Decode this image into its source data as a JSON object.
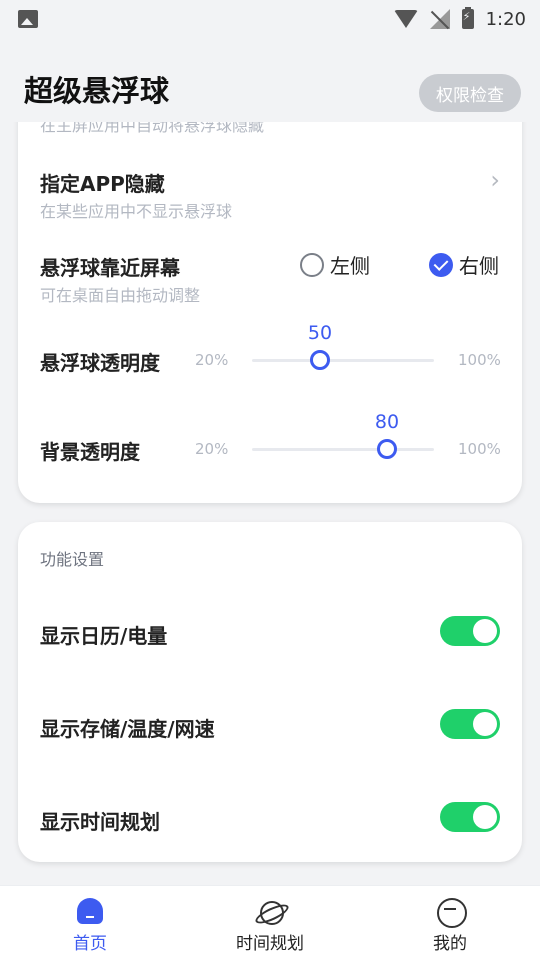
{
  "status_bar": {
    "time": "1:20"
  },
  "header": {
    "title": "超级悬浮球",
    "permission_button": "权限检查"
  },
  "floating_settings": {
    "clipped_hint": "在主屏应用中自动将悬浮球隐藏",
    "hide_in_apps": {
      "title": "指定APP隐藏",
      "subtitle": "在某些应用中不显示悬浮球"
    },
    "edge_position": {
      "title": "悬浮球靠近屏幕",
      "subtitle": "可在桌面自由拖动调整",
      "options": [
        {
          "label": "左侧",
          "selected": false
        },
        {
          "label": "右侧",
          "selected": true
        }
      ]
    },
    "ball_opacity": {
      "title": "悬浮球透明度",
      "min_label": "20%",
      "max_label": "100%",
      "value": "50",
      "min": 20,
      "max": 100
    },
    "bg_opacity": {
      "title": "背景透明度",
      "min_label": "20%",
      "max_label": "100%",
      "value": "80",
      "min": 20,
      "max": 100
    }
  },
  "feature_settings": {
    "section_title": "功能设置",
    "toggles": [
      {
        "label": "显示日历/电量",
        "on": true
      },
      {
        "label": "显示存储/温度/网速",
        "on": true
      },
      {
        "label": "显示时间规划",
        "on": true
      }
    ]
  },
  "bottom_nav": {
    "items": [
      {
        "label": "首页",
        "icon": "home-icon",
        "active": true
      },
      {
        "label": "时间规划",
        "icon": "planet-icon",
        "active": false
      },
      {
        "label": "我的",
        "icon": "face-icon",
        "active": false
      }
    ]
  },
  "colors": {
    "accent": "#3d5bf0",
    "switch_on": "#1fd06a"
  }
}
